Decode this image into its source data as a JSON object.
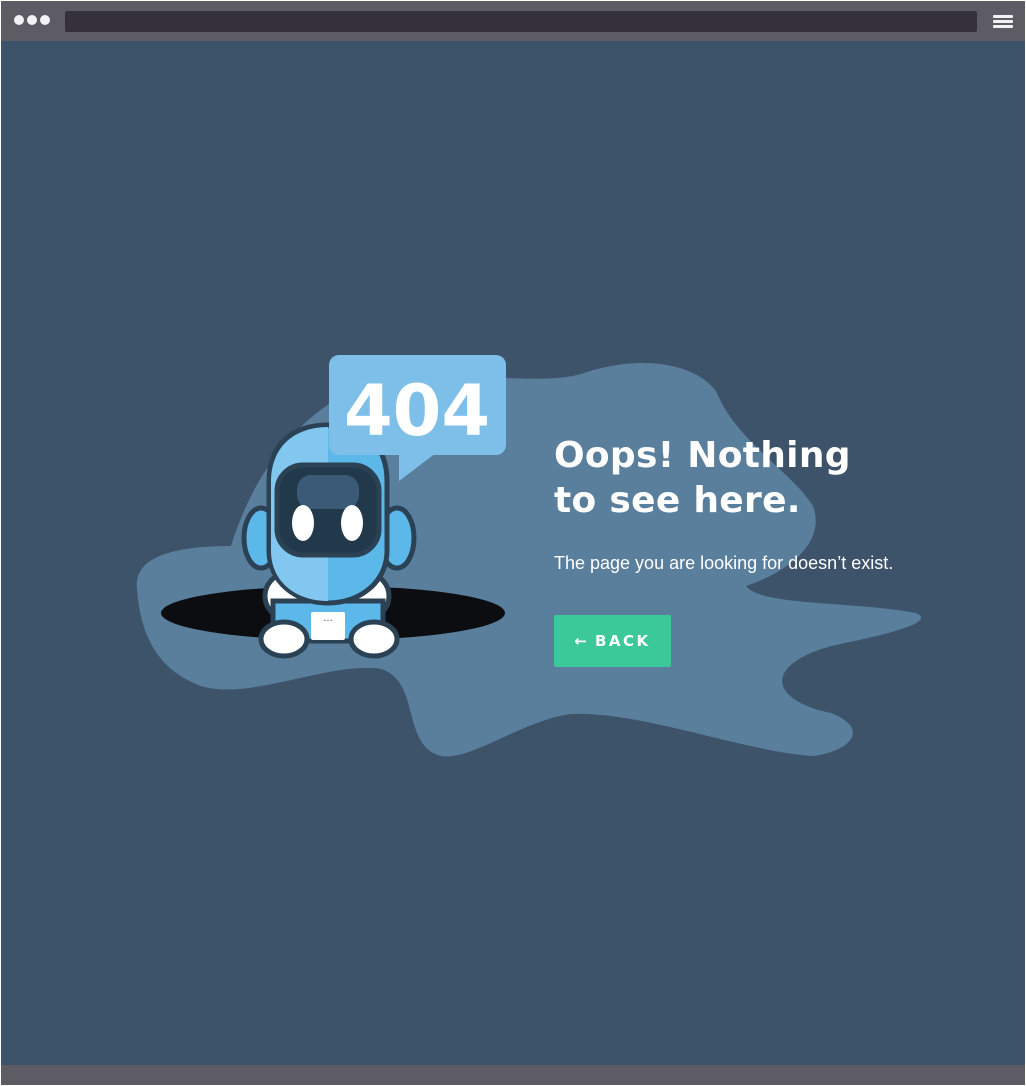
{
  "browser": {
    "dots_icon": "window-dots-icon",
    "menu_icon": "hamburger-menu-icon"
  },
  "error": {
    "code": "404",
    "headline": "Oops! Nothing\nto see here.",
    "message": "The page you are looking for doesn’t exist.",
    "back_arrow": "←",
    "back_label": "BACK"
  },
  "colors": {
    "background": "#3c536a",
    "blob": "#5a7f9c",
    "bubble": "#7ebfe9",
    "button": "#3cc99a",
    "chrome": "#5d5b63"
  }
}
